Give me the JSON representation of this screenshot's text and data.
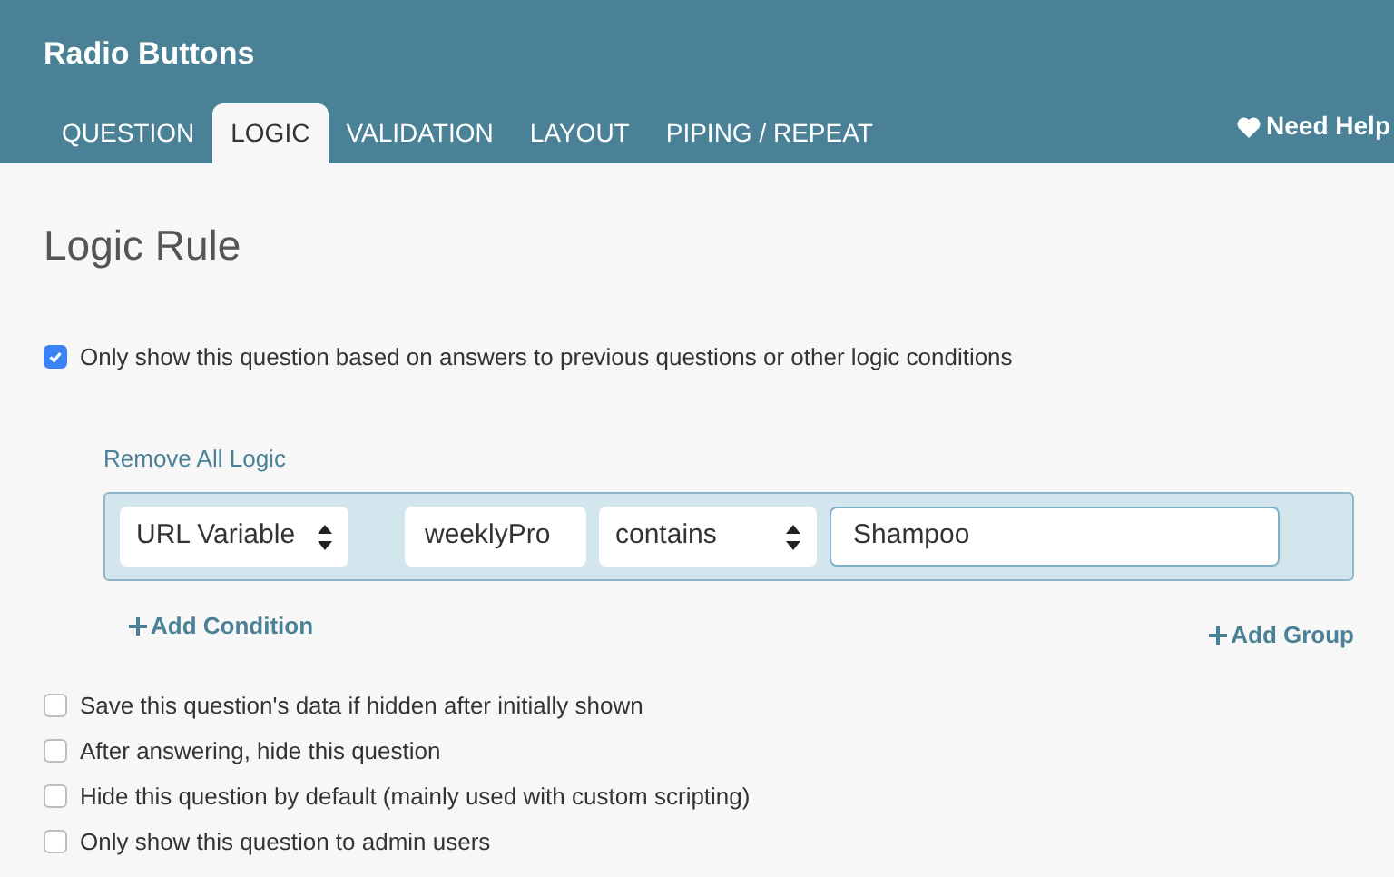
{
  "header": {
    "title": "Radio Buttons"
  },
  "tabs": [
    {
      "label": "QUESTION",
      "selected": false
    },
    {
      "label": "LOGIC",
      "selected": true
    },
    {
      "label": "VALIDATION",
      "selected": false
    },
    {
      "label": "LAYOUT",
      "selected": false
    },
    {
      "label": "PIPING / REPEAT",
      "selected": false
    }
  ],
  "help_link": "Need Help",
  "section_title": "Logic Rule",
  "main_option": {
    "label": "Only show this question based on answers to previous questions or other logic conditions",
    "checked": true
  },
  "remove_all_link": "Remove All Logic",
  "condition": [
    {
      "kind": "select",
      "value": "URL Variable"
    },
    {
      "kind": "input",
      "value": "weeklyPro"
    },
    {
      "kind": "select",
      "value": "contains"
    },
    {
      "kind": "text",
      "value": "Shampoo"
    }
  ],
  "add_condition": "Add Condition",
  "add_group": "Add Group",
  "options": [
    {
      "label": "Save this question's data if hidden after initially shown",
      "checked": false
    },
    {
      "label": "After answering, hide this question",
      "checked": false
    },
    {
      "label": "Hide this question by default (mainly used with custom scripting)",
      "checked": false
    },
    {
      "label": "Only show this question to admin users",
      "checked": false
    }
  ]
}
